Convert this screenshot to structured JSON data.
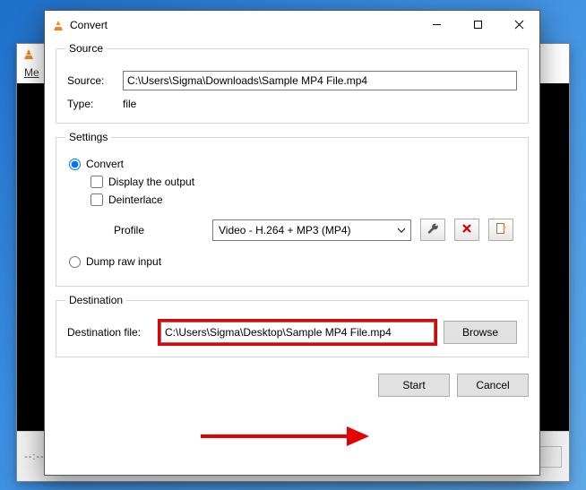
{
  "dialog": {
    "title": "Convert",
    "source": {
      "legend": "Source",
      "source_label": "Source:",
      "source_value": "C:\\Users\\Sigma\\Downloads\\Sample MP4 File.mp4",
      "type_label": "Type:",
      "type_value": "file"
    },
    "settings": {
      "legend": "Settings",
      "convert_label": "Convert",
      "display_label": "Display the output",
      "deinterlace_label": "Deinterlace",
      "profile_label": "Profile",
      "profile_value": "Video - H.264 + MP3 (MP4)",
      "dump_label": "Dump raw input"
    },
    "destination": {
      "legend": "Destination",
      "file_label": "Destination file:",
      "file_value": "C:\\Users\\Sigma\\Desktop\\Sample MP4 File.mp4",
      "browse_label": "Browse"
    },
    "buttons": {
      "start": "Start",
      "cancel": "Cancel"
    }
  },
  "bg": {
    "menu": "Me",
    "time": "--:--"
  }
}
